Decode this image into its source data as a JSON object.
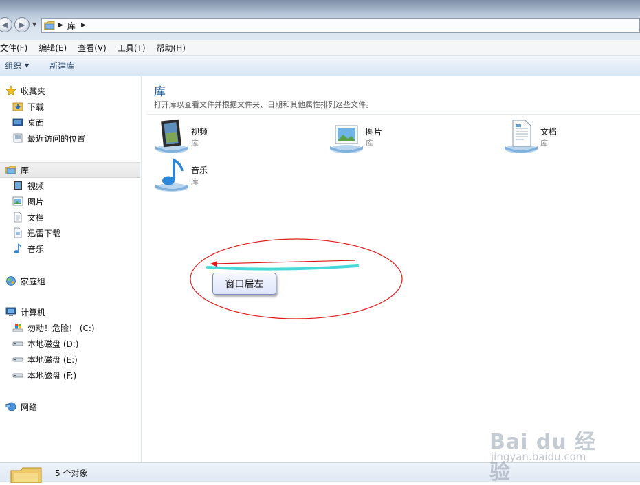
{
  "address": {
    "segment": "库"
  },
  "menu": [
    "文件(F)",
    "编辑(E)",
    "查看(V)",
    "工具(T)",
    "帮助(H)"
  ],
  "toolbar": {
    "organize": "组织",
    "new_library": "新建库"
  },
  "sidebar": {
    "favorites": {
      "label": "收藏夹",
      "items": [
        "下载",
        "桌面",
        "最近访问的位置"
      ]
    },
    "libraries": {
      "label": "库",
      "items": [
        "视频",
        "图片",
        "文档",
        "迅雷下载",
        "音乐"
      ]
    },
    "homegroup": "家庭组",
    "computer": {
      "label": "计算机",
      "items": [
        "勿动！危险！ (C:)",
        "本地磁盘 (D:)",
        "本地磁盘 (E:)",
        "本地磁盘 (F:)"
      ]
    },
    "network": "网络"
  },
  "main": {
    "title": "库",
    "description": "打开库以查看文件并根据文件夹、日期和其他属性排列这些文件。",
    "libraries": [
      {
        "name": "视频",
        "type": "库",
        "icon": "video-library-icon"
      },
      {
        "name": "图片",
        "type": "库",
        "icon": "pictures-library-icon"
      },
      {
        "name": "文档",
        "type": "库",
        "icon": "documents-library-icon"
      },
      {
        "name": "音乐",
        "type": "库",
        "icon": "music-library-icon"
      }
    ]
  },
  "annotation": {
    "label": "窗口居左",
    "ellipse_color": "#e01b1b",
    "arrow_color": "#e01b1b",
    "underline_color": "#47d8d8"
  },
  "status": {
    "count_text": "5 个对象"
  },
  "watermark": {
    "brand": "Bai du 经验",
    "url": "jingyan.baidu.com"
  }
}
